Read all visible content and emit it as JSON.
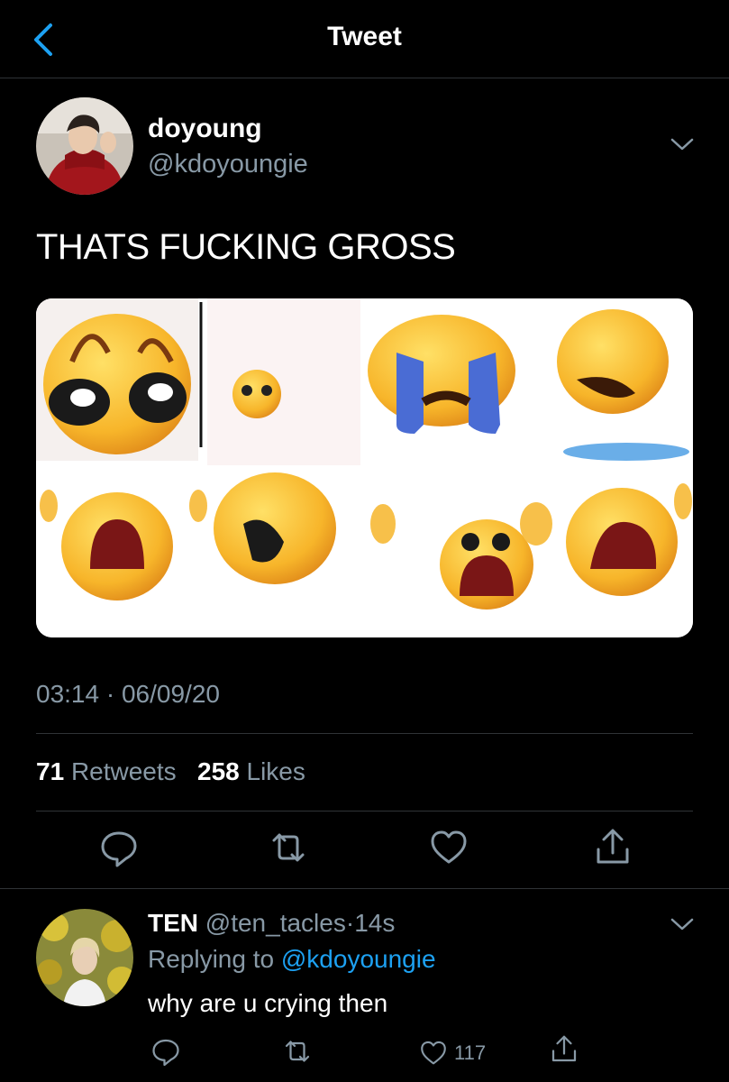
{
  "header": {
    "title": "Tweet",
    "back_icon": "chevron-left-icon"
  },
  "tweet": {
    "author_name": "doyoung",
    "author_handle": "@kdoyoungie",
    "text": "THATS FUCKING GROSS",
    "time": "03:14",
    "separator": "·",
    "date": "06/09/20",
    "retweets_count": "71",
    "retweets_label": "Retweets",
    "likes_count": "258",
    "likes_label": "Likes",
    "media_description_icons": [
      "pleading-face",
      "crying-face",
      "loudly-crying-face",
      "crying-hands-face"
    ]
  },
  "reply": {
    "author_name": "TEN",
    "author_handle": "@ten_tacles",
    "separator": "·",
    "time": "14s",
    "replying_label": "Replying to",
    "replying_handle": "@kdoyoungie",
    "text": "why are u crying then",
    "like_count": "117"
  },
  "colors": {
    "background": "#000000",
    "muted": "#8899a6",
    "link": "#1da1f2",
    "divider": "#2f3336"
  }
}
